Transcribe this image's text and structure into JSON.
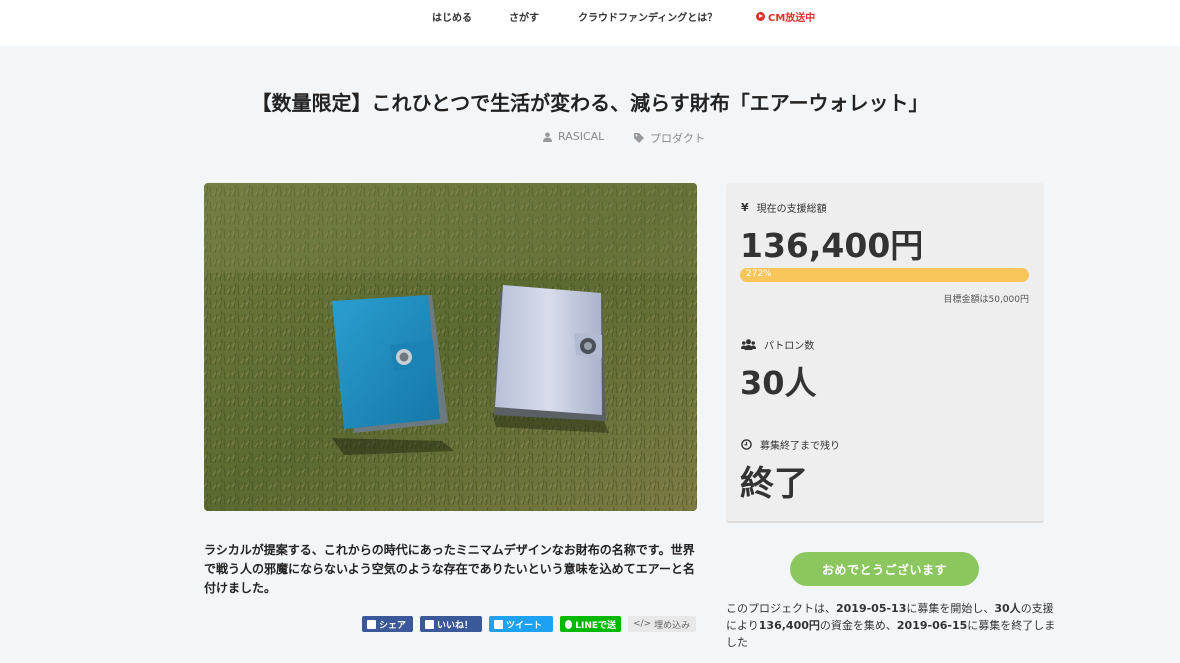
{
  "nav": {
    "items": [
      "はじめる",
      "さがす",
      "クラウドファンディングとは？"
    ],
    "cm_label": "CM放送中"
  },
  "project": {
    "title": "【数量限定】これひとつで生活が変わる、減らす財布「エアーウォレット」",
    "author": "RASICAL",
    "category": "プロダクト",
    "description": "ラシカルが提案する、これからの時代にあったミニマムデザインなお財布の名称です。世界で戦う人の邪魔にならないよう空気のような存在でありたいという意味を込めてエアーと名付けました。"
  },
  "stats": {
    "currency_icon": "¥",
    "total_label": "現在の支援総額",
    "total_value": "136,400円",
    "progress_percent": 272,
    "progress_label": "272%",
    "goal_text": "目標金額は50,000円",
    "patrons_label": "パトロン数",
    "patrons_value": "30人",
    "remaining_label": "募集終了まで残り",
    "remaining_value": "終了"
  },
  "share": {
    "facebook": "シェア",
    "like": "いいね！",
    "tweet": "ツイート",
    "line": "LINEで送",
    "embed": "埋め込み"
  },
  "congrats_label": "おめでとうございます",
  "summary": {
    "p1": "このプロジェクトは、",
    "start_date": "2019-05-13",
    "p2": "に募集を開始し、",
    "patrons": "30人",
    "p3": "の支援により",
    "amount": "136,400円",
    "p4": "の資金を集め、",
    "end_date": "2019-06-15",
    "p5": "に募集を終了しました"
  },
  "colors": {
    "accent_red": "#e0322b",
    "progress": "#f7c55a",
    "congrats": "#8cc65e",
    "facebook": "#3b5998",
    "twitter": "#1da1f2",
    "line": "#00b900"
  }
}
